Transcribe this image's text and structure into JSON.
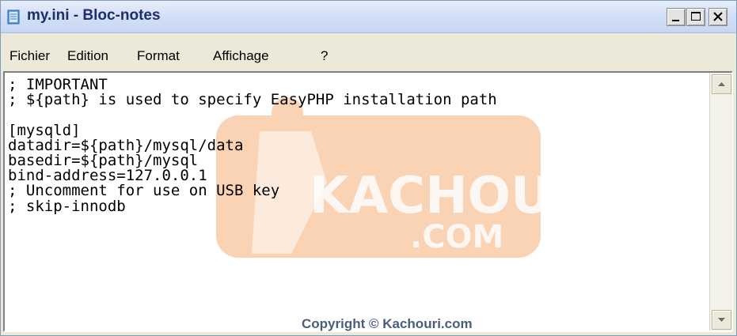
{
  "window": {
    "title": "my.ini - Bloc-notes",
    "buttons": {
      "minimize": "_",
      "maximize": "□",
      "close": "✕"
    }
  },
  "menu": {
    "items": [
      "Fichier",
      "Edition",
      "Format",
      "Affichage",
      "?"
    ]
  },
  "editor": {
    "lines": [
      "; IMPORTANT",
      "; ${path} is used to specify EasyPHP installation path",
      "",
      "[mysqld]",
      "datadir=${path}/mysql/data",
      "basedir=${path}/mysql",
      "bind-address=127.0.0.1",
      "; Uncomment for use on USB key",
      "; skip-innodb"
    ]
  },
  "watermark": {
    "text": "KACHOURI",
    "domain": ".COM",
    "copyright": "Copyright © Kachouri.com"
  },
  "colors": {
    "titlebar": "#d4e0f7",
    "watermark_orange": "#f6a66c"
  }
}
